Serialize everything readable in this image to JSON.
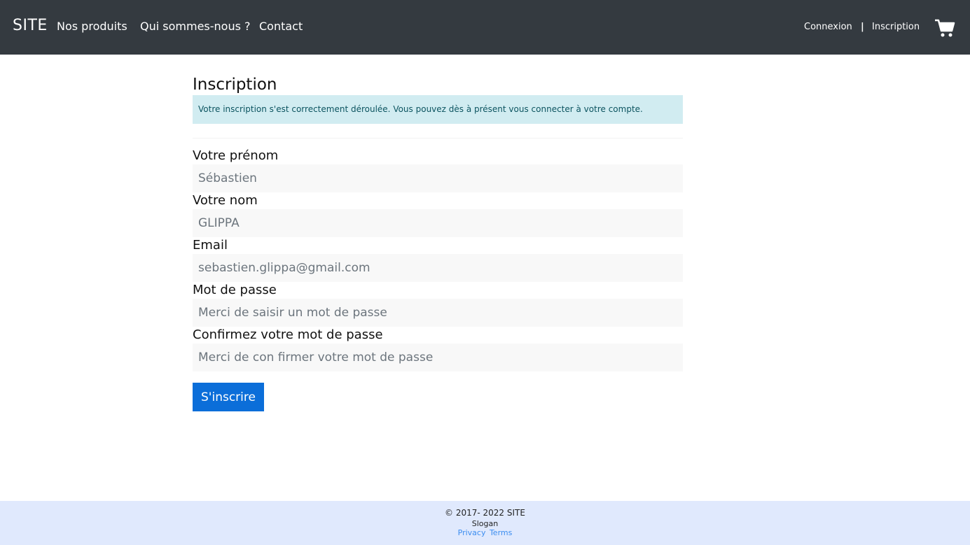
{
  "navbar": {
    "brand": "SITE",
    "links": [
      "Nos produits",
      "Qui sommes-nous ?",
      "Contact"
    ],
    "login": "Connexion",
    "separator": "|",
    "signup": "Inscription"
  },
  "main": {
    "title": "Inscription",
    "alert": "Votre inscription s'est correctement déroulée. Vous pouvez dès à présent vous connecter à votre compte.",
    "fields": [
      {
        "label": "Votre prénom",
        "value": "",
        "placeholder": "Sébastien"
      },
      {
        "label": "Votre nom",
        "value": "",
        "placeholder": "GLIPPA"
      },
      {
        "label": "Email",
        "value": "",
        "placeholder": "sebastien.glippa@gmail.com"
      },
      {
        "label": "Mot de passe",
        "value": "",
        "placeholder": "Merci de saisir un mot de passe"
      },
      {
        "label": "Confirmez votre mot de passe",
        "value": "",
        "placeholder": "Merci de con firmer votre mot de passe"
      }
    ],
    "submit_label": "S'inscrire"
  },
  "footer": {
    "copyright": "© 2017-  2022 SITE",
    "slogan": "Slogan",
    "links": [
      "Privacy",
      "Terms"
    ]
  },
  "colors": {
    "navbar_bg": "#343a40",
    "alert_bg": "#d1ecf1",
    "button_bg": "#0b6ed9",
    "footer_bg": "#e0e9fd",
    "link": "#3b8df0"
  },
  "icons": {
    "cart": "shopping-cart-icon"
  }
}
